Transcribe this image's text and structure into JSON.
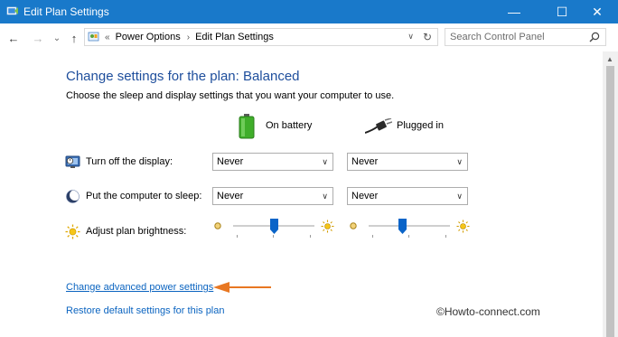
{
  "window": {
    "title": "Edit Plan Settings",
    "minimize_glyph": "—",
    "maximize_glyph": "☐",
    "close_glyph": "✕"
  },
  "nav": {
    "back_glyph": "←",
    "forward_glyph": "→",
    "dropdown_glyph": "⌄",
    "up_glyph": "↑"
  },
  "address": {
    "overflow": "«",
    "breadcrumbs": [
      "Power Options",
      "Edit Plan Settings"
    ],
    "separator": "›",
    "dropdown_glyph": "∨",
    "refresh_glyph": "↻"
  },
  "search": {
    "placeholder": "Search Control Panel"
  },
  "main": {
    "heading": "Change settings for the plan: Balanced",
    "subheading": "Choose the sleep and display settings that you want your computer to use.",
    "columns": {
      "battery": "On battery",
      "plugged": "Plugged in"
    },
    "rows": {
      "display": {
        "label": "Turn off the display:",
        "battery_value": "Never",
        "plugged_value": "Never"
      },
      "sleep": {
        "label": "Put the computer to sleep:",
        "battery_value": "Never",
        "plugged_value": "Never"
      },
      "brightness": {
        "label": "Adjust plan brightness:",
        "battery_level": 0.5,
        "plugged_level": 0.42
      }
    },
    "chevron": "∨",
    "advanced_link": "Change advanced power settings",
    "restore_link": "Restore default settings for this plan"
  },
  "annotation": {
    "arrow_color": "#e87722"
  },
  "watermark": "©Howto-connect.com",
  "colors": {
    "titlebar": "#1979ca",
    "heading": "#1e4e9c",
    "link": "#0b64c0"
  }
}
